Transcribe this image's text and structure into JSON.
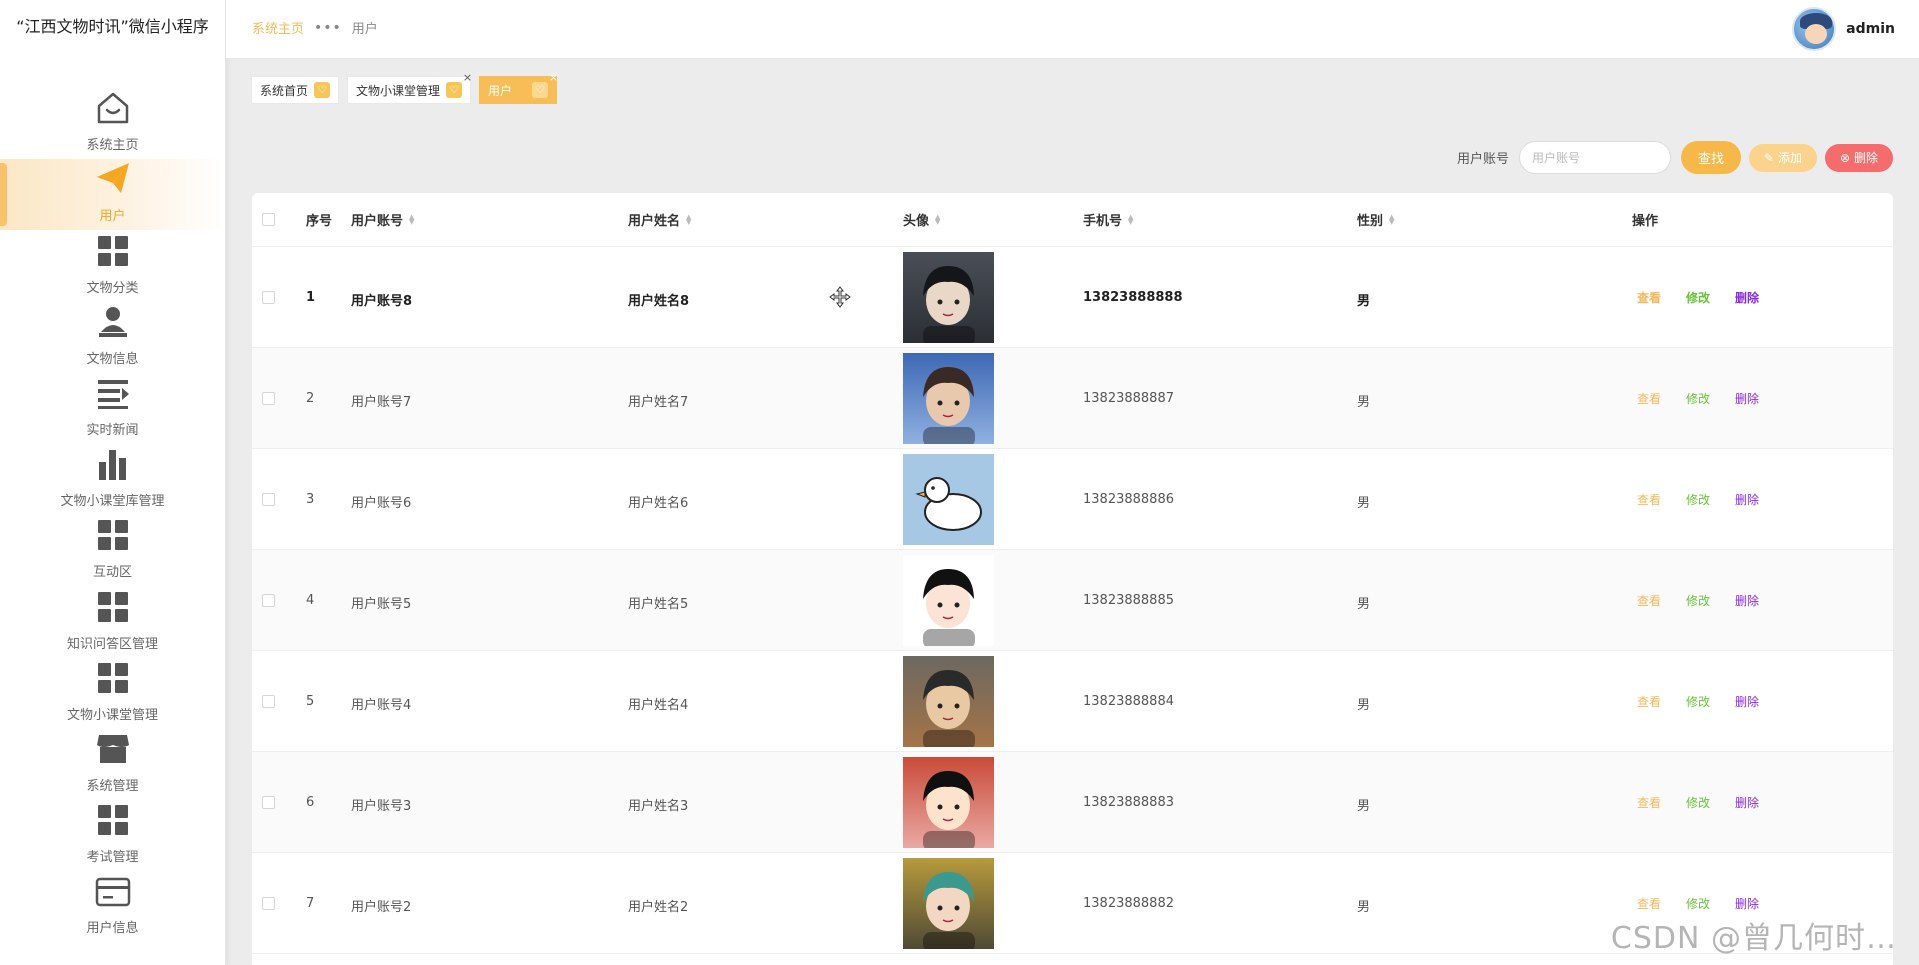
{
  "app": {
    "title": "“江西文物时讯”微信小程序"
  },
  "sidebar": {
    "items": [
      {
        "label": "系统主页",
        "icon": "home-icon"
      },
      {
        "label": "用户",
        "icon": "paper-plane-icon",
        "active": true
      },
      {
        "label": "文物分类",
        "icon": "grid-icon"
      },
      {
        "label": "文物信息",
        "icon": "user-stamp-icon"
      },
      {
        "label": "实时新闻",
        "icon": "list-icon"
      },
      {
        "label": "文物小课堂库管理",
        "icon": "bar-chart-icon"
      },
      {
        "label": "互动区",
        "icon": "grid-icon"
      },
      {
        "label": "知识问答区管理",
        "icon": "grid-icon"
      },
      {
        "label": "文物小课堂管理",
        "icon": "grid-icon"
      },
      {
        "label": "系统管理",
        "icon": "shop-icon"
      },
      {
        "label": "考试管理",
        "icon": "grid-icon"
      },
      {
        "label": "用户信息",
        "icon": "card-icon"
      }
    ]
  },
  "header": {
    "breadcrumb": {
      "home": "系统主页",
      "separator": "•••",
      "current": "用户"
    },
    "user": {
      "name": "admin"
    }
  },
  "tags": [
    {
      "label": "系统首页",
      "badge": "♡",
      "active": false,
      "closable": false
    },
    {
      "label": "文物小课堂管理",
      "badge": "♡",
      "active": false,
      "closable": true,
      "close": "×"
    },
    {
      "label": "用户",
      "badge": "♡",
      "active": true,
      "closable": true,
      "close": "×"
    }
  ],
  "search": {
    "label": "用户账号",
    "placeholder": "用户账号",
    "search_button": "查找",
    "add_button": "添加",
    "delete_button": "删除"
  },
  "table": {
    "columns": [
      "序号",
      "用户账号",
      "用户姓名",
      "头像",
      "手机号",
      "性别",
      "操作"
    ],
    "rows": [
      {
        "index": "1",
        "account": "用户账号8",
        "name": "用户姓名8",
        "avatar": "dark-hair-anime-boy",
        "phone": "13823888888",
        "gender": "男"
      },
      {
        "index": "2",
        "account": "用户账号7",
        "name": "用户姓名7",
        "avatar": "boy-pink-shirt",
        "phone": "13823888887",
        "gender": "男"
      },
      {
        "index": "3",
        "account": "用户账号6",
        "name": "用户姓名6",
        "avatar": "white-duck",
        "phone": "13823888886",
        "gender": "男"
      },
      {
        "index": "4",
        "account": "用户账号5",
        "name": "用户姓名5",
        "avatar": "cartoon-girl-bob",
        "phone": "13823888885",
        "gender": "男"
      },
      {
        "index": "5",
        "account": "用户账号4",
        "name": "用户姓名4",
        "avatar": "ninja-mask-boy",
        "phone": "13823888884",
        "gender": "男"
      },
      {
        "index": "6",
        "account": "用户账号3",
        "name": "用户姓名3",
        "avatar": "shinchan-costume",
        "phone": "13823888883",
        "gender": "男"
      },
      {
        "index": "7",
        "account": "用户账号2",
        "name": "用户姓名2",
        "avatar": "green-hair-girl",
        "phone": "13823888882",
        "gender": "男"
      }
    ],
    "actions": {
      "view": "查看",
      "edit": "修改",
      "delete": "删除"
    }
  },
  "watermark": "CSDN @曾几何时…",
  "colors": {
    "accent": "#f7bd56",
    "danger": "#f56c6c",
    "edit": "#67c23a",
    "delete_link": "#8a2be2"
  }
}
